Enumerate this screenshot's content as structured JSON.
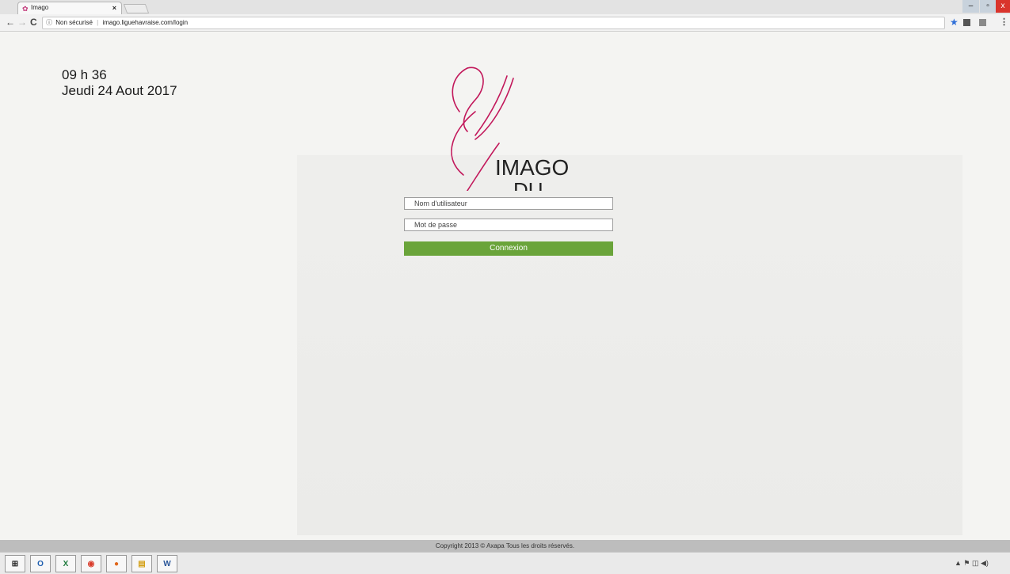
{
  "browser": {
    "tab_title": "Imago",
    "tab_close": "×",
    "security_label": "Non sécurisé",
    "url": "imago.liguehavraise.com/login",
    "back": "←",
    "forward": "→",
    "reload": "C",
    "star": "★",
    "menu": "⋮"
  },
  "window_controls": {
    "minimize": "–",
    "maximize": "▫",
    "close": "x"
  },
  "page": {
    "time": "09 h 36",
    "date": "Jeudi 24 Aout 2017",
    "logo_line1": "IMAGO",
    "logo_line2": "DU",
    "logo_color": "#c2185b"
  },
  "login": {
    "username_placeholder": "Nom d'utilisateur",
    "password_placeholder": "Mot de passe",
    "submit_label": "Connexion",
    "submit_color": "#6aa43a"
  },
  "footer": {
    "copyright": "Copyright 2013 © Axapa Tous les droits réservés."
  },
  "taskbar": {
    "icons": [
      "windows-icon",
      "outlook-icon",
      "excel-icon",
      "chrome-icon",
      "firefox-icon",
      "file-explorer-icon",
      "word-icon"
    ],
    "tray": "▲ ⚑ ◫ ◀)"
  }
}
